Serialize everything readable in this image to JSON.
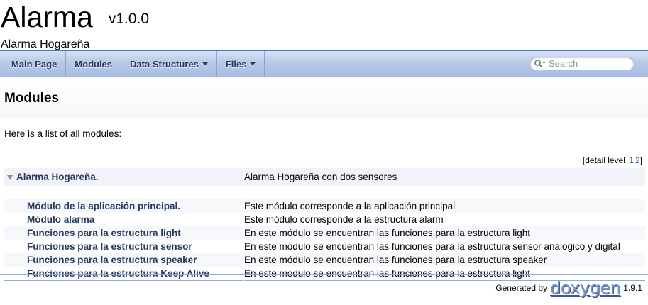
{
  "project": {
    "name": "Alarma",
    "number": "v1.0.0",
    "brief": "Alarma Hogareña"
  },
  "nav": {
    "items": [
      {
        "label": "Main Page",
        "dropdown": false
      },
      {
        "label": "Modules",
        "dropdown": false
      },
      {
        "label": "Data Structures",
        "dropdown": true
      },
      {
        "label": "Files",
        "dropdown": true
      }
    ],
    "search_placeholder": "Search"
  },
  "page": {
    "title": "Modules",
    "intro": "Here is a list of all modules:",
    "detail_level_label": "[detail level",
    "detail_levels": [
      "1",
      "2"
    ],
    "detail_level_close": "]"
  },
  "modules": {
    "top": {
      "name": "Alarma Hogareña.",
      "description": "Alarma Hogareña con dos sensores"
    },
    "children": [
      {
        "name": "Módulo de la aplicación principal.",
        "description": "Este módulo corresponde a la aplicación principal"
      },
      {
        "name": "Módulo alarma",
        "description": "Este módulo corresponde a la estructura alarm"
      },
      {
        "name": "Funciones para la estructura light",
        "description": "En este módulo se encuentran las funciones para la estructura light"
      },
      {
        "name": "Funciones para la estructura sensor",
        "description": "En este módulo se encuentran las funciones para la estructura sensor analogico y digital"
      },
      {
        "name": "Funciones para la estructura speaker",
        "description": "En este módulo se encuentran las funciones para la estructura speaker"
      },
      {
        "name": "Funciones para la estructura Keep Alive",
        "description": "En este módulo se encuentran las funciones para la estructura light"
      }
    ]
  },
  "footer": {
    "generated_by": "Generated by",
    "logo": "doxygen",
    "version": "1.9.1"
  },
  "colors": {
    "nav_text": "#283a5d",
    "link": "#3d578c",
    "border": "#9ca9c7"
  }
}
